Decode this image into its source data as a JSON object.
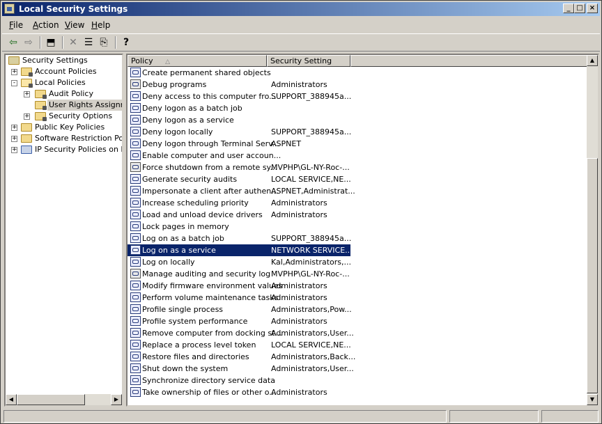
{
  "window": {
    "title": "Local Security Settings"
  },
  "title_buttons": {
    "minimize": "_",
    "maximize": "□",
    "close": "×"
  },
  "menu": [
    {
      "letter": "F",
      "rest": "ile"
    },
    {
      "letter": "A",
      "rest": "ction"
    },
    {
      "letter": "V",
      "rest": "iew"
    },
    {
      "letter": "H",
      "rest": "elp"
    }
  ],
  "toolbar_icons": {
    "back": "⇦",
    "forward": "⇨",
    "up": "⬒",
    "delete": "✕",
    "properties": "☰",
    "export": "⎘",
    "help": "?"
  },
  "tree": {
    "items": [
      {
        "label": "Security Settings",
        "expander": "",
        "lock": false
      },
      {
        "label": "Account Policies",
        "expander": "+",
        "lock": true
      },
      {
        "label": "Local Policies",
        "expander": "-",
        "lock": true
      },
      {
        "label": "Audit Policy",
        "expander": "+",
        "lock": true
      },
      {
        "label": "User Rights Assignment",
        "expander": "",
        "lock": true,
        "selected": true
      },
      {
        "label": "Security Options",
        "expander": "+",
        "lock": true
      },
      {
        "label": "Public Key Policies",
        "expander": "+",
        "lock": false
      },
      {
        "label": "Software Restriction Policies",
        "expander": "+",
        "lock": false
      },
      {
        "label": "IP Security Policies on Local Computer",
        "expander": "+",
        "lock": false
      }
    ]
  },
  "list": {
    "columns": {
      "policy": "Policy",
      "setting": "Security Setting",
      "sort_glyph": "△"
    },
    "rows": [
      {
        "policy": "Create permanent shared objects",
        "setting": ""
      },
      {
        "policy": "Debug programs",
        "setting": "Administrators",
        "alt": true
      },
      {
        "policy": "Deny access to this computer fro...",
        "setting": "SUPPORT_388945a..."
      },
      {
        "policy": "Deny logon as a batch job",
        "setting": ""
      },
      {
        "policy": "Deny logon as a service",
        "setting": ""
      },
      {
        "policy": "Deny logon locally",
        "setting": "SUPPORT_388945a..."
      },
      {
        "policy": "Deny logon through Terminal Serv...",
        "setting": "ASPNET"
      },
      {
        "policy": "Enable computer and user accoun...",
        "setting": ""
      },
      {
        "policy": "Force shutdown from a remote sy...",
        "setting": "MVPHP\\GL-NY-Roc-...",
        "alt": true
      },
      {
        "policy": "Generate security audits",
        "setting": "LOCAL SERVICE,NE..."
      },
      {
        "policy": "Impersonate a client after authen...",
        "setting": "ASPNET,Administrat..."
      },
      {
        "policy": "Increase scheduling priority",
        "setting": "Administrators"
      },
      {
        "policy": "Load and unload device drivers",
        "setting": "Administrators"
      },
      {
        "policy": "Lock pages in memory",
        "setting": ""
      },
      {
        "policy": "Log on as a batch job",
        "setting": "SUPPORT_388945a..."
      },
      {
        "policy": "Log on as a service",
        "setting": "NETWORK SERVICE...",
        "selected": true
      },
      {
        "policy": "Log on locally",
        "setting": "Kal,Administrators,..."
      },
      {
        "policy": "Manage auditing and security log",
        "setting": "MVPHP\\GL-NY-Roc-...",
        "alt": true
      },
      {
        "policy": "Modify firmware environment values",
        "setting": "Administrators"
      },
      {
        "policy": "Perform volume maintenance tasks",
        "setting": "Administrators"
      },
      {
        "policy": "Profile single process",
        "setting": "Administrators,Pow..."
      },
      {
        "policy": "Profile system performance",
        "setting": "Administrators"
      },
      {
        "policy": "Remove computer from docking st...",
        "setting": "Administrators,User..."
      },
      {
        "policy": "Replace a process level token",
        "setting": "LOCAL SERVICE,NE..."
      },
      {
        "policy": "Restore files and directories",
        "setting": "Administrators,Back..."
      },
      {
        "policy": "Shut down the system",
        "setting": "Administrators,User..."
      },
      {
        "policy": "Synchronize directory service data",
        "setting": ""
      },
      {
        "policy": "Take ownership of files or other o...",
        "setting": "Administrators"
      }
    ]
  },
  "scroll_arrows": {
    "left": "◀",
    "right": "▶",
    "up": "▲",
    "down": "▼"
  },
  "colors": {
    "title_start": "#0a246a",
    "title_end": "#a6caf0",
    "selection": "#0a246a",
    "face": "#d4d0c8"
  }
}
